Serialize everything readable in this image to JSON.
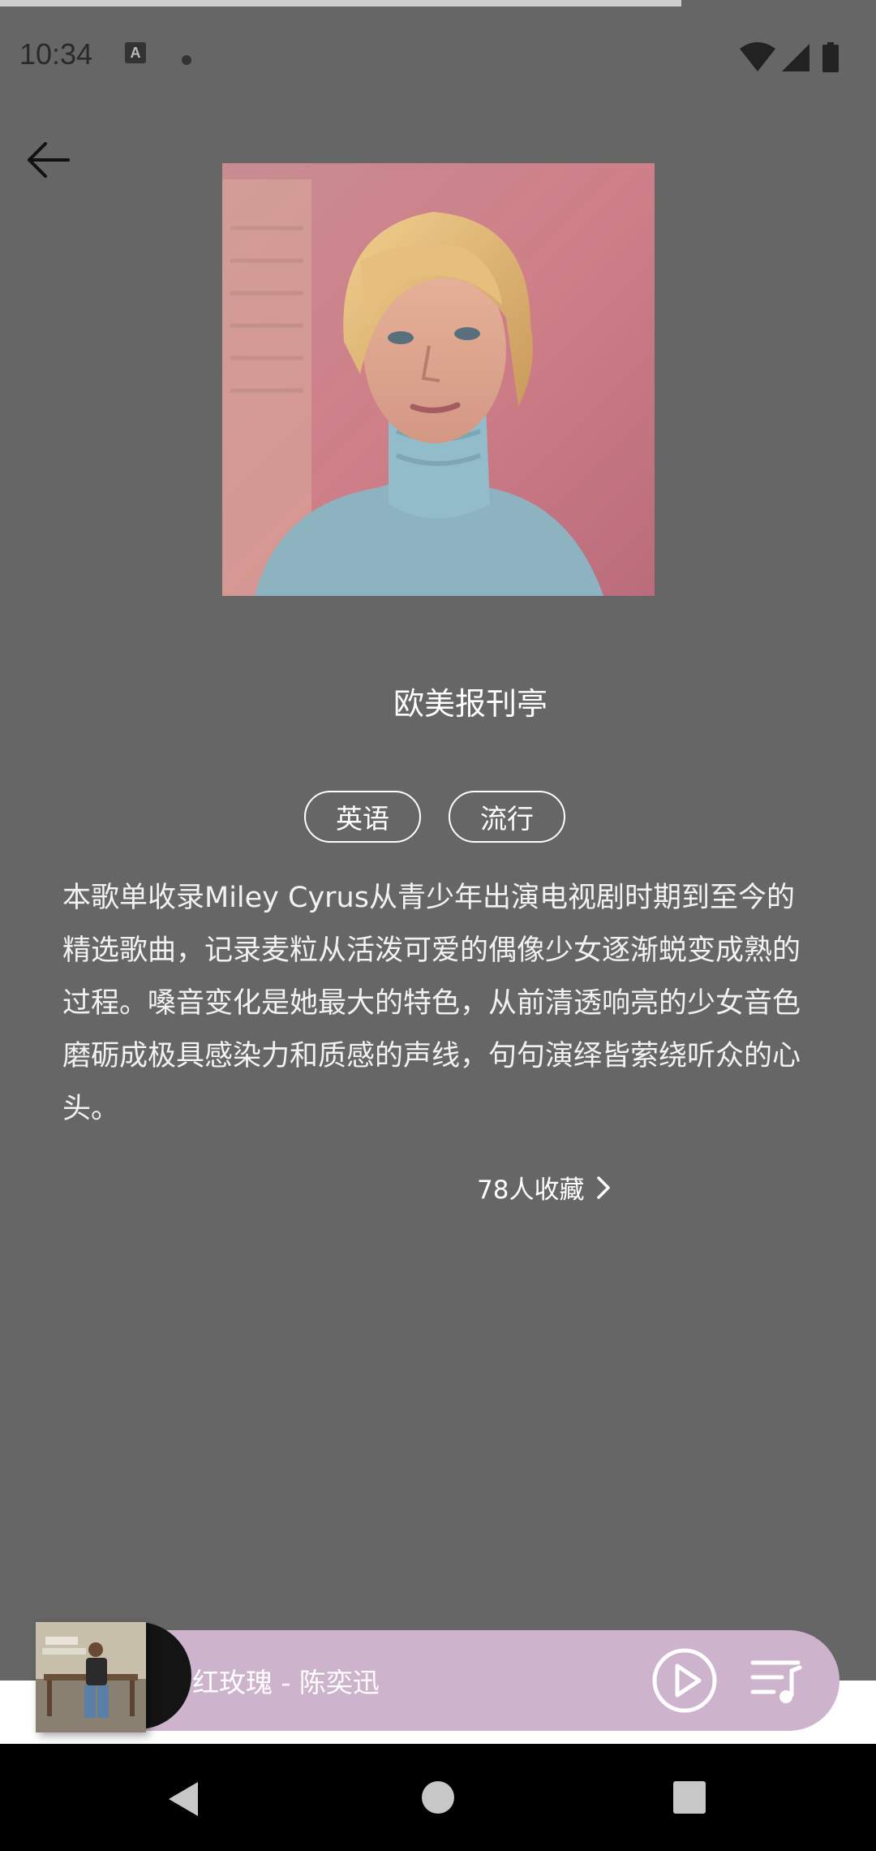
{
  "status_bar": {
    "time": "10:34",
    "input_indicator": "A",
    "icons": [
      "notification-dot-icon",
      "wifi-icon",
      "signal-icon",
      "battery-icon"
    ]
  },
  "header": {
    "back_icon": "arrow-left-icon"
  },
  "playlist": {
    "title": "欧美报刊亭",
    "tags": [
      "英语",
      "流行"
    ],
    "description": "本歌单收录Miley Cyrus从青少年出演电视剧时期到至今的精选歌曲，记录麦粒从活泼可爱的偶像少女逐渐蜕变成熟的过程。嗓音变化是她最大的特色，从前清透响亮的少女音色磨砺成极具感染力和质感的声线，句句演绎皆萦绕听众的心头。",
    "collect_text": "78人收藏",
    "collect_icon": "chevron-right-icon"
  },
  "mini_player": {
    "song": "红玫瑰 - 陈奕迅",
    "play_icon": "play-circle-icon",
    "queue_icon": "playlist-icon",
    "bar_color": "#cdb3cc"
  },
  "nav_bar": {
    "icons": [
      "nav-back-icon",
      "nav-home-icon",
      "nav-recents-icon"
    ]
  },
  "colors": {
    "background": "#666666",
    "player_bar": "#cdb3cc",
    "nav_bar": "#000000"
  }
}
